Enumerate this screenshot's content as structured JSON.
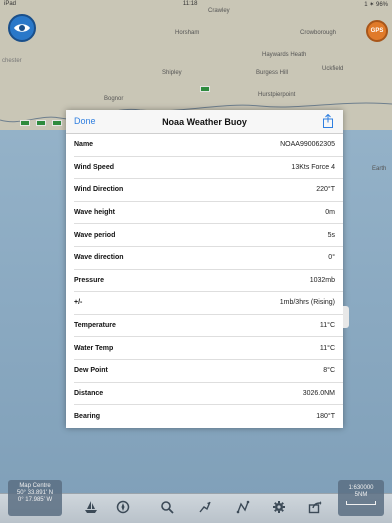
{
  "status_bar": {
    "left": "iPad",
    "center": "11:18",
    "right": "1 ✶ 96%"
  },
  "map": {
    "labels": [
      {
        "text": "Crawley"
      },
      {
        "text": "Horsham"
      },
      {
        "text": "Crowborough"
      },
      {
        "text": "Haywards Heath"
      },
      {
        "text": "Shipley"
      },
      {
        "text": "Burgess Hill"
      },
      {
        "text": "Uckfield"
      },
      {
        "text": "Hurstpierpoint"
      },
      {
        "text": "Bognor"
      },
      {
        "text": "chester"
      },
      {
        "text": "Earth"
      }
    ],
    "gps_label": "GPS"
  },
  "dialog": {
    "done_label": "Done",
    "title": "Noaa Weather Buoy",
    "rows": [
      {
        "label": "Name",
        "value": "NOAA990062305"
      },
      {
        "label": "Wind Speed",
        "value": "13Kts Force 4"
      },
      {
        "label": "Wind Direction",
        "value": "220°T"
      },
      {
        "label": "Wave height",
        "value": "0m"
      },
      {
        "label": "Wave period",
        "value": "5s"
      },
      {
        "label": "Wave direction",
        "value": "0°"
      },
      {
        "label": "Pressure",
        "value": "1032mb"
      },
      {
        "label": "+/-",
        "value": "1mb/3hrs (Rising)"
      },
      {
        "label": "Temperature",
        "value": "11°C"
      },
      {
        "label": "Water Temp",
        "value": "11°C"
      },
      {
        "label": "Dew Point",
        "value": "8°C"
      },
      {
        "label": "Distance",
        "value": "3026.0NM"
      },
      {
        "label": "Bearing",
        "value": "180°T"
      }
    ]
  },
  "map_centre": {
    "title": "Map Centre",
    "lat": "50° 33.891' N",
    "lon": "0° 17.985' W"
  },
  "scale": {
    "value": "1:630000",
    "distance": "5NM"
  },
  "toolbar": {
    "icons": [
      "boat-icon",
      "compass-icon",
      "search-icon",
      "route-icon",
      "track-icon",
      "settings-icon",
      "share-icon"
    ]
  },
  "colors": {
    "accent": "#2f7fe0",
    "gps": "#e07a2a",
    "eye": "#2a78c9"
  }
}
